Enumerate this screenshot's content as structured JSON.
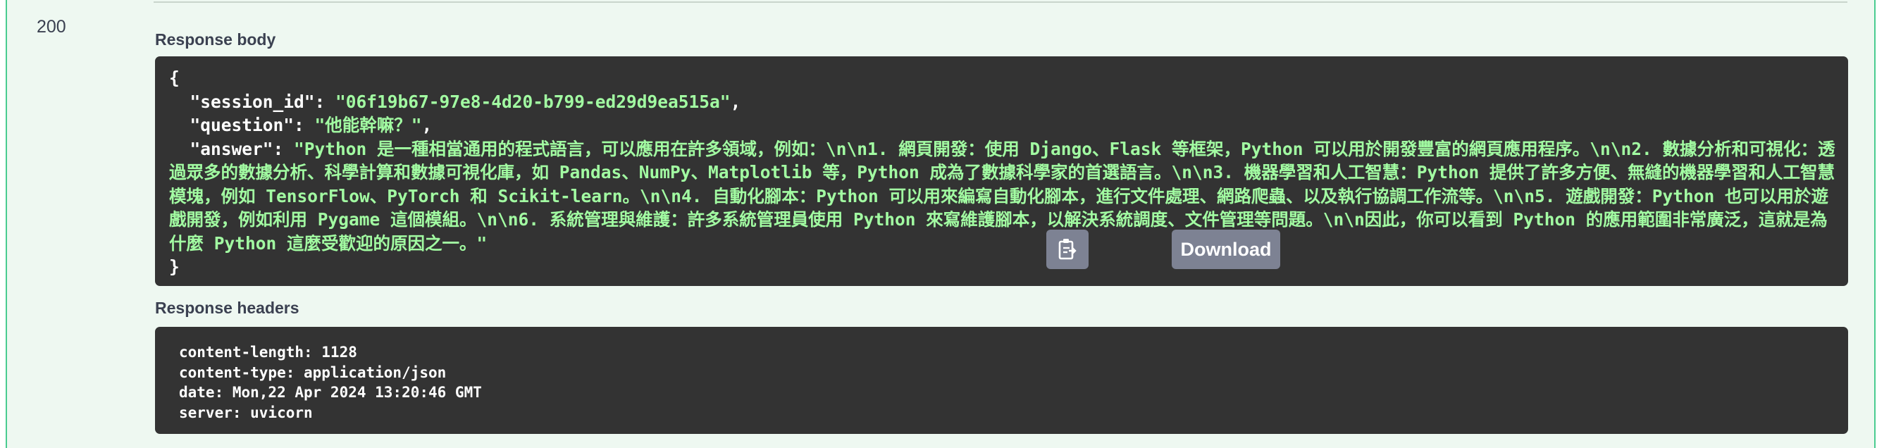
{
  "status_code": "200",
  "response_body": {
    "label": "Response body",
    "open_brace": "{",
    "close_brace": "}",
    "fields": [
      {
        "key": "\"session_id\"",
        "value": "\"06f19b67-97e8-4d20-b799-ed29d9ea515a\""
      },
      {
        "key": "\"question\"",
        "value": "\"他能幹嘛？\""
      },
      {
        "key": "\"answer\"",
        "value": "\"Python 是一種相當通用的程式語言，可以應用在許多領域，例如：\\n\\n1. 網頁開發：使用 Django、Flask 等框架，Python 可以用於開發豐富的網頁應用程序。\\n\\n2. 數據分析和可視化：透過眾多的數據分析、科學計算和數據可視化庫，如 Pandas、NumPy、Matplotlib 等，Python 成為了數據科學家的首選語言。\\n\\n3. 機器學習和人工智慧：Python 提供了許多方便、無縫的機器學習和人工智慧模塊，例如 TensorFlow、PyTorch 和 Scikit-learn。\\n\\n4. 自動化腳本：Python 可以用來編寫自動化腳本，進行文件處理、網路爬蟲、以及執行協調工作流等。\\n\\n5. 遊戲開發：Python 也可以用於遊戲開發，例如利用 Pygame 這個模組。\\n\\n6. 系統管理與維護：許多系統管理員使用 Python 來寫維護腳本，以解決系統調度、文件管理等問題。\\n\\n因此，你可以看到 Python 的應用範圍非常廣泛，這就是為什麼 Python 這麼受歡迎的原因之一。\""
      }
    ],
    "copy_icon": "clipboard-icon",
    "download_label": "Download"
  },
  "response_headers": {
    "label": "Response headers",
    "lines": [
      "content-length: 1128",
      "content-type: application/json",
      "date: Mon,22 Apr 2024 13:20:46 GMT",
      "server: uvicorn"
    ]
  },
  "colors": {
    "panel_bg": "#eef8f1",
    "panel_border": "#49cc90",
    "code_bg": "#333333",
    "string_green": "#a2fca2",
    "button_gray": "#7d8293"
  }
}
